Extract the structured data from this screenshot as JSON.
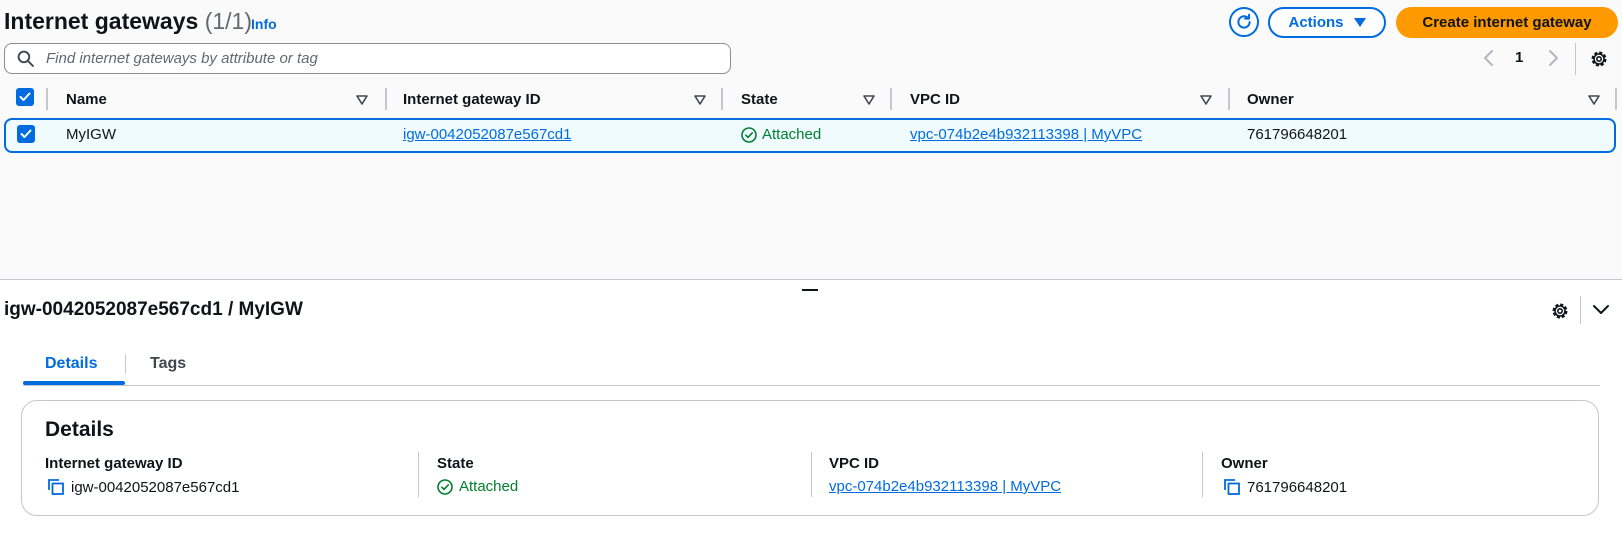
{
  "header": {
    "title": "Internet gateways",
    "count": "(1/1)",
    "info": "Info",
    "actions_label": "Actions",
    "create_label": "Create internet gateway"
  },
  "search": {
    "placeholder": "Find internet gateways by attribute or tag"
  },
  "pagination": {
    "page": "1"
  },
  "table": {
    "columns": [
      "Name",
      "Internet gateway ID",
      "State",
      "VPC ID",
      "Owner"
    ],
    "rows": [
      {
        "name": "MyIGW",
        "id": "igw-0042052087e567cd1",
        "state": "Attached",
        "vpc": "vpc-074b2e4b932113398 | MyVPC",
        "owner": "761796648201",
        "selected": true
      }
    ]
  },
  "detail": {
    "title": "igw-0042052087e567cd1 / MyIGW",
    "tabs": [
      "Details",
      "Tags"
    ],
    "active_tab": "Details",
    "card_title": "Details",
    "fields": [
      {
        "label": "Internet gateway ID",
        "value": "igw-0042052087e567cd1"
      },
      {
        "label": "State",
        "value": "Attached"
      },
      {
        "label": "VPC ID",
        "value": "vpc-074b2e4b932113398 | MyVPC"
      },
      {
        "label": "Owner",
        "value": "761796648201"
      }
    ]
  },
  "colors": {
    "accent": "#006ce0",
    "primary_button": "#ff9900",
    "success": "#00802f",
    "selected_row_bg": "#f0fbff"
  },
  "icons": [
    "refresh-icon",
    "caret-down-icon",
    "search-icon",
    "chevron-left-icon",
    "chevron-right-icon",
    "gear-icon",
    "checkmark-icon",
    "sort-icon",
    "status-success-icon",
    "copy-icon",
    "chevron-down-icon"
  ]
}
